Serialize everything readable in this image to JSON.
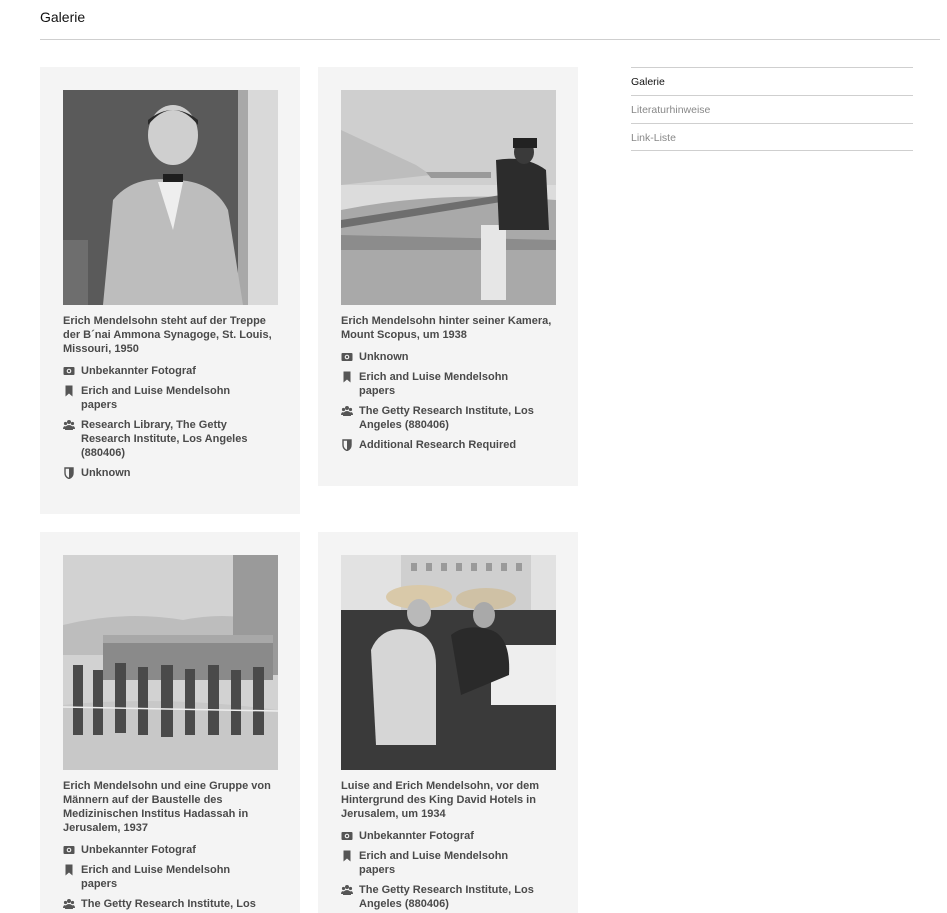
{
  "page": {
    "title": "Galerie"
  },
  "sidebar": {
    "items": [
      {
        "label": "Galerie",
        "active": true
      },
      {
        "label": "Literaturhinweise",
        "active": false
      },
      {
        "label": "Link-Liste",
        "active": false
      }
    ]
  },
  "cards": [
    {
      "caption": "Erich Mendelsohn steht auf der Treppe der B´nai Ammona Synagoge, St. Louis, Missouri, 1950",
      "photographer": "Unbekannter Fotograf",
      "collection": "Erich and Luise Mendelsohn papers",
      "institution": "Research Library, The Getty Research Institute, Los Angeles (880406)",
      "rights": "Unknown"
    },
    {
      "caption": "Erich Mendelsohn hinter seiner Kamera, Mount Scopus, um 1938",
      "photographer": "Unknown",
      "collection": "Erich and Luise Mendelsohn papers",
      "institution": "The Getty Research Institute, Los Angeles (880406)",
      "rights": "Additional Research Required"
    },
    {
      "caption": "Erich Mendelsohn und eine Gruppe von Männern auf der Baustelle des Medizinischen Institus Hadassah in Jerusalem, 1937",
      "photographer": "Unbekannter Fotograf",
      "collection": "Erich and Luise Mendelsohn papers",
      "institution": "The Getty Research Institute, Los"
    },
    {
      "caption": "Luise and Erich Mendelsohn, vor dem Hintergrund des King David Hotels in Jerusalem, um 1934",
      "photographer": "Unbekannter Fotograf",
      "collection": "Erich and Luise Mendelsohn papers",
      "institution": "The Getty Research Institute, Los Angeles (880406)"
    }
  ],
  "icons": {
    "photographer": "camera-icon",
    "collection": "bookmark-icon",
    "institution": "group-icon",
    "rights": "shield-icon"
  },
  "colors": {
    "card_bg": "#f4f4f4",
    "text": "#4a4a4a",
    "rule": "#cfcfcf"
  }
}
